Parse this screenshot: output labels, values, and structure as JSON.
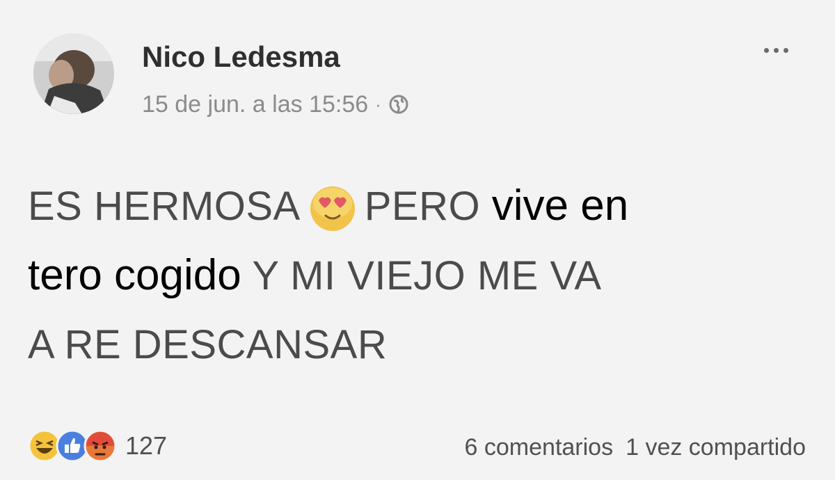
{
  "post": {
    "author": "Nico Ledesma",
    "timestamp": "15 de jun. a las 15:56",
    "separator": "·",
    "privacy_icon": "globe-icon",
    "more_icon": "more-options-icon",
    "text": {
      "line1_a": "ES HERMOSA",
      "line1_emoji": "heart-eyes-emoji",
      "line1_b": "PERO",
      "line1_overlay": "vive en",
      "line2_overlay": "tero cogido",
      "line2_b": "Y MI VIEJO ME VA",
      "line3": "A RE DESCANSAR"
    }
  },
  "footer": {
    "reactions": [
      "haha-reaction-icon",
      "like-reaction-icon",
      "angry-reaction-icon"
    ],
    "reaction_count": "127",
    "comments": "6 comentarios",
    "shares": "1 vez compartido"
  },
  "colors": {
    "background": "#f3f3f3",
    "author": "#2f2f2f",
    "meta": "#8b8b8b",
    "body_text": "#4b4b4b",
    "overlay_text": "#000000",
    "like_blue": "#4a7fe0",
    "angry_red": "#e14b3c",
    "haha_yellow": "#f5c33b"
  }
}
